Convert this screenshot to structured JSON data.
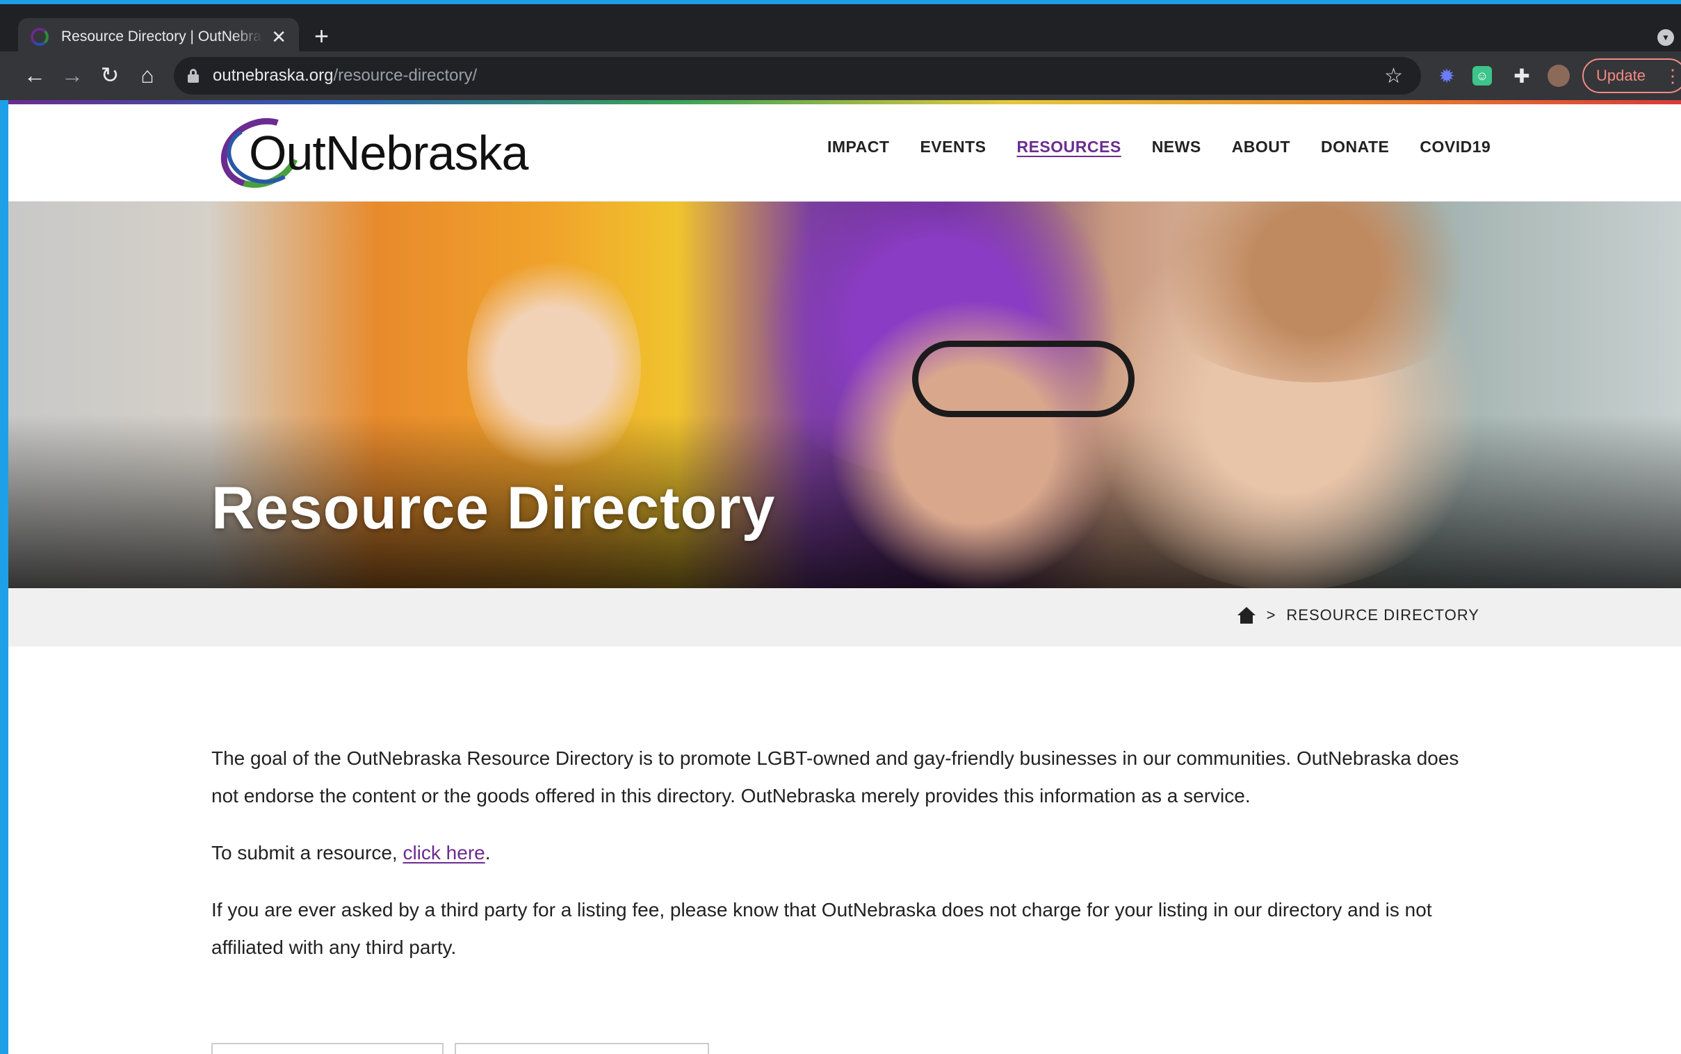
{
  "browser": {
    "tab_title": "Resource Directory | OutNebraska",
    "tab_close": "✕",
    "new_tab": "+",
    "url_host": "outnebraska.org",
    "url_path": "/resource-directory/",
    "update_label": "Update",
    "menu_dots": "⋮"
  },
  "site": {
    "logo_text": "OutNebraska",
    "nav": [
      {
        "label": "IMPACT"
      },
      {
        "label": "EVENTS"
      },
      {
        "label": "RESOURCES",
        "active": true
      },
      {
        "label": "NEWS"
      },
      {
        "label": "ABOUT"
      },
      {
        "label": "DONATE"
      },
      {
        "label": "COVID19"
      }
    ],
    "accent_color": "#6b2c91"
  },
  "hero": {
    "title": "Resource Directory"
  },
  "breadcrumb": {
    "separator": ">",
    "current": "RESOURCE DIRECTORY"
  },
  "content": {
    "intro": "The goal of the OutNebraska Resource Directory is to promote LGBT-owned and gay-friendly businesses in our communities. OutNebraska does not endorse the content or the goods offered in this directory. OutNebraska merely provides this information as a service.",
    "submit_prefix": "To submit a resource, ",
    "submit_link": "click here",
    "submit_suffix": ".",
    "fee_notice": "If you are ever asked by a third party for a listing fee, please know that OutNebraska does not charge for your listing in our directory and is not affiliated with any third party."
  }
}
